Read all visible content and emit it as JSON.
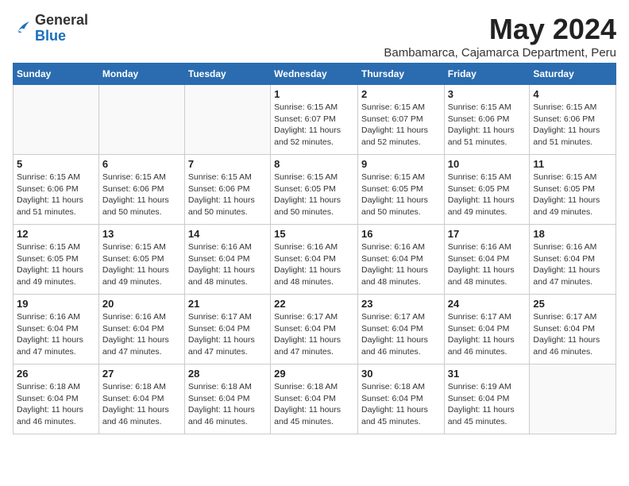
{
  "header": {
    "logo_line1": "General",
    "logo_line2": "Blue",
    "month_title": "May 2024",
    "subtitle": "Bambamarca, Cajamarca Department, Peru"
  },
  "calendar": {
    "days_of_week": [
      "Sunday",
      "Monday",
      "Tuesday",
      "Wednesday",
      "Thursday",
      "Friday",
      "Saturday"
    ],
    "weeks": [
      [
        {
          "day": "",
          "info": ""
        },
        {
          "day": "",
          "info": ""
        },
        {
          "day": "",
          "info": ""
        },
        {
          "day": "1",
          "info": "Sunrise: 6:15 AM\nSunset: 6:07 PM\nDaylight: 11 hours and 52 minutes."
        },
        {
          "day": "2",
          "info": "Sunrise: 6:15 AM\nSunset: 6:07 PM\nDaylight: 11 hours and 52 minutes."
        },
        {
          "day": "3",
          "info": "Sunrise: 6:15 AM\nSunset: 6:06 PM\nDaylight: 11 hours and 51 minutes."
        },
        {
          "day": "4",
          "info": "Sunrise: 6:15 AM\nSunset: 6:06 PM\nDaylight: 11 hours and 51 minutes."
        }
      ],
      [
        {
          "day": "5",
          "info": "Sunrise: 6:15 AM\nSunset: 6:06 PM\nDaylight: 11 hours and 51 minutes."
        },
        {
          "day": "6",
          "info": "Sunrise: 6:15 AM\nSunset: 6:06 PM\nDaylight: 11 hours and 50 minutes."
        },
        {
          "day": "7",
          "info": "Sunrise: 6:15 AM\nSunset: 6:06 PM\nDaylight: 11 hours and 50 minutes."
        },
        {
          "day": "8",
          "info": "Sunrise: 6:15 AM\nSunset: 6:05 PM\nDaylight: 11 hours and 50 minutes."
        },
        {
          "day": "9",
          "info": "Sunrise: 6:15 AM\nSunset: 6:05 PM\nDaylight: 11 hours and 50 minutes."
        },
        {
          "day": "10",
          "info": "Sunrise: 6:15 AM\nSunset: 6:05 PM\nDaylight: 11 hours and 49 minutes."
        },
        {
          "day": "11",
          "info": "Sunrise: 6:15 AM\nSunset: 6:05 PM\nDaylight: 11 hours and 49 minutes."
        }
      ],
      [
        {
          "day": "12",
          "info": "Sunrise: 6:15 AM\nSunset: 6:05 PM\nDaylight: 11 hours and 49 minutes."
        },
        {
          "day": "13",
          "info": "Sunrise: 6:15 AM\nSunset: 6:05 PM\nDaylight: 11 hours and 49 minutes."
        },
        {
          "day": "14",
          "info": "Sunrise: 6:16 AM\nSunset: 6:04 PM\nDaylight: 11 hours and 48 minutes."
        },
        {
          "day": "15",
          "info": "Sunrise: 6:16 AM\nSunset: 6:04 PM\nDaylight: 11 hours and 48 minutes."
        },
        {
          "day": "16",
          "info": "Sunrise: 6:16 AM\nSunset: 6:04 PM\nDaylight: 11 hours and 48 minutes."
        },
        {
          "day": "17",
          "info": "Sunrise: 6:16 AM\nSunset: 6:04 PM\nDaylight: 11 hours and 48 minutes."
        },
        {
          "day": "18",
          "info": "Sunrise: 6:16 AM\nSunset: 6:04 PM\nDaylight: 11 hours and 47 minutes."
        }
      ],
      [
        {
          "day": "19",
          "info": "Sunrise: 6:16 AM\nSunset: 6:04 PM\nDaylight: 11 hours and 47 minutes."
        },
        {
          "day": "20",
          "info": "Sunrise: 6:16 AM\nSunset: 6:04 PM\nDaylight: 11 hours and 47 minutes."
        },
        {
          "day": "21",
          "info": "Sunrise: 6:17 AM\nSunset: 6:04 PM\nDaylight: 11 hours and 47 minutes."
        },
        {
          "day": "22",
          "info": "Sunrise: 6:17 AM\nSunset: 6:04 PM\nDaylight: 11 hours and 47 minutes."
        },
        {
          "day": "23",
          "info": "Sunrise: 6:17 AM\nSunset: 6:04 PM\nDaylight: 11 hours and 46 minutes."
        },
        {
          "day": "24",
          "info": "Sunrise: 6:17 AM\nSunset: 6:04 PM\nDaylight: 11 hours and 46 minutes."
        },
        {
          "day": "25",
          "info": "Sunrise: 6:17 AM\nSunset: 6:04 PM\nDaylight: 11 hours and 46 minutes."
        }
      ],
      [
        {
          "day": "26",
          "info": "Sunrise: 6:18 AM\nSunset: 6:04 PM\nDaylight: 11 hours and 46 minutes."
        },
        {
          "day": "27",
          "info": "Sunrise: 6:18 AM\nSunset: 6:04 PM\nDaylight: 11 hours and 46 minutes."
        },
        {
          "day": "28",
          "info": "Sunrise: 6:18 AM\nSunset: 6:04 PM\nDaylight: 11 hours and 46 minutes."
        },
        {
          "day": "29",
          "info": "Sunrise: 6:18 AM\nSunset: 6:04 PM\nDaylight: 11 hours and 45 minutes."
        },
        {
          "day": "30",
          "info": "Sunrise: 6:18 AM\nSunset: 6:04 PM\nDaylight: 11 hours and 45 minutes."
        },
        {
          "day": "31",
          "info": "Sunrise: 6:19 AM\nSunset: 6:04 PM\nDaylight: 11 hours and 45 minutes."
        },
        {
          "day": "",
          "info": ""
        }
      ]
    ]
  }
}
